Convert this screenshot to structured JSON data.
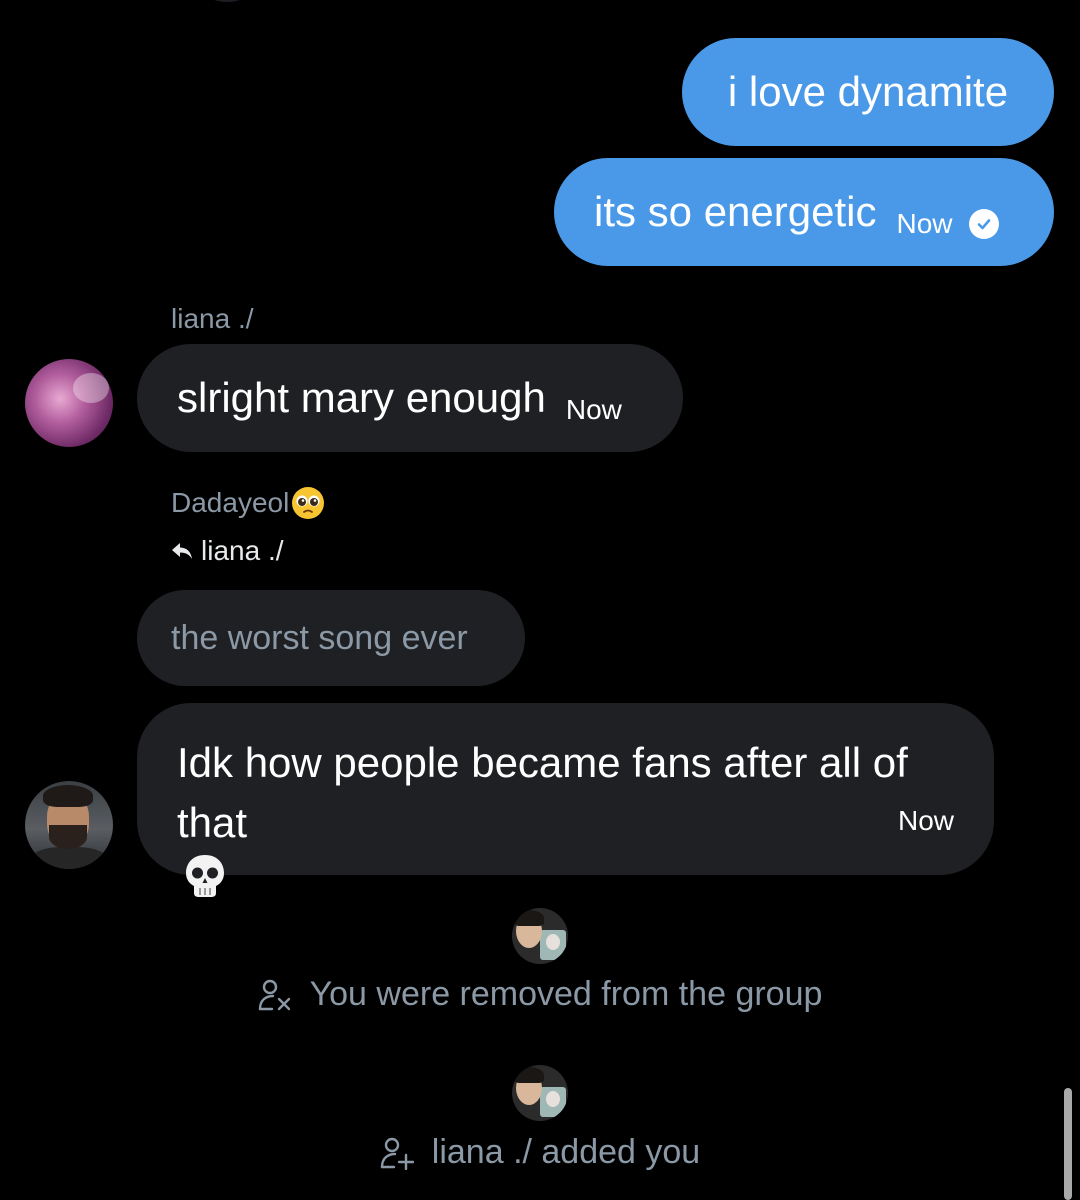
{
  "outgoing": [
    {
      "text": "i love dynamite"
    },
    {
      "text": "its so energetic",
      "time": "Now",
      "status": "seen"
    }
  ],
  "messages": [
    {
      "sender": "liana ./",
      "text": "slright mary enough",
      "time": "Now"
    },
    {
      "sender": "Dadayeol",
      "reply_to": "liana ./",
      "quoted": "the worst song ever",
      "text": "Idk how people became fans after all of that",
      "time": "Now"
    }
  ],
  "system": [
    {
      "icon": "person-remove-icon",
      "text": "You were removed from the group"
    },
    {
      "icon": "person-add-icon",
      "text": "liana ./ added you"
    }
  ],
  "colors": {
    "outgoing_bubble": "#4a99e9",
    "incoming_bubble": "#1f2023",
    "muted_text": "#8b98a5",
    "background": "#000000"
  }
}
